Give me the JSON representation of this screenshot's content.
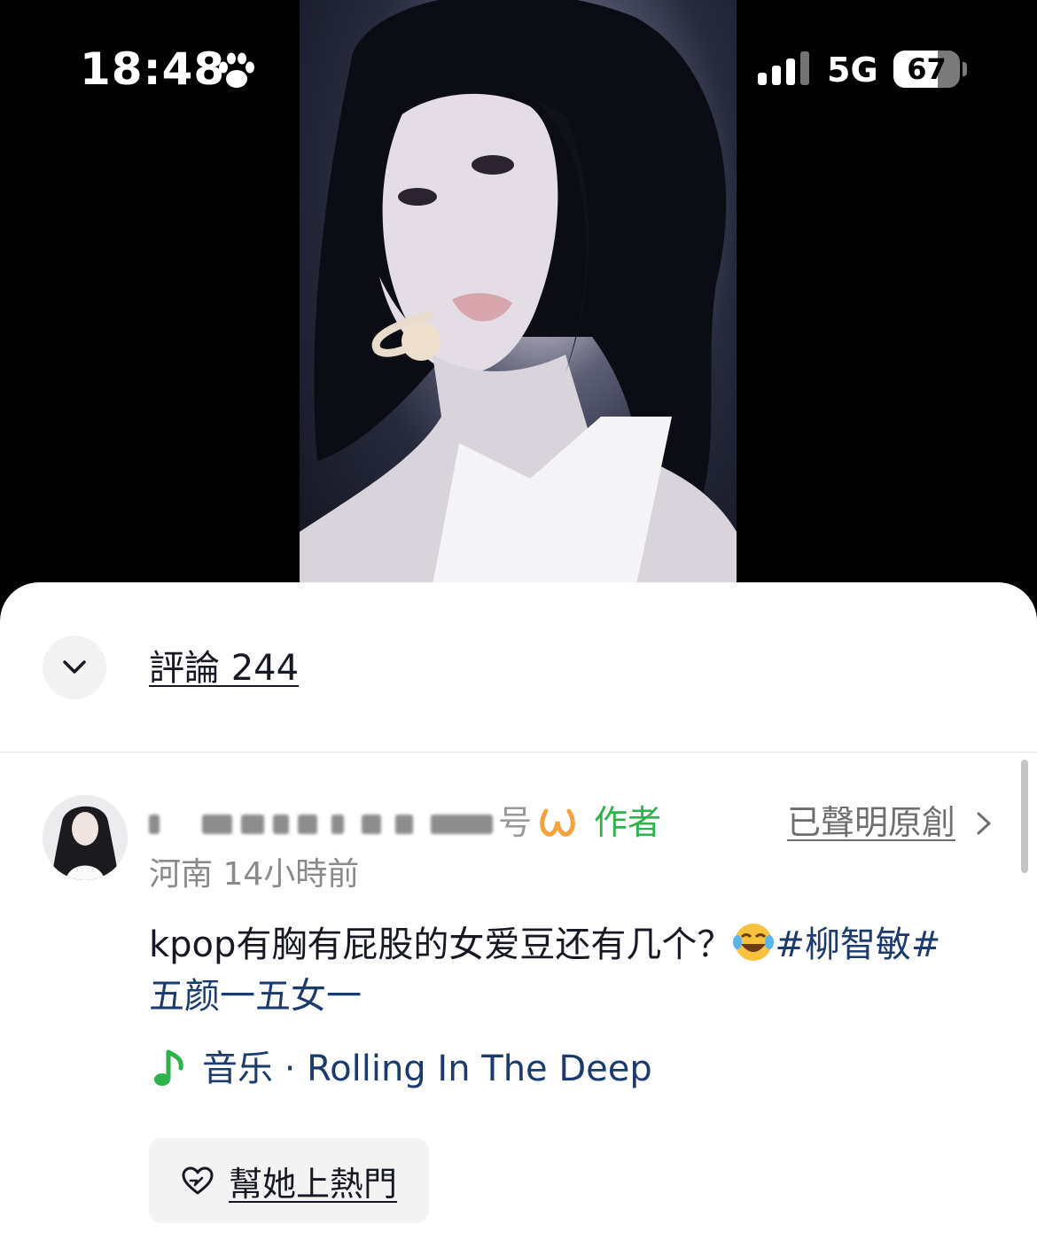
{
  "status_bar": {
    "time": "18:48",
    "time_icon": "paw-icon",
    "signal_icon": "cellular-signal-icon",
    "network": "5G",
    "battery_level": "67",
    "battery_fraction": 0.67
  },
  "video": {
    "content": "performer-closeup-photo"
  },
  "comments_panel": {
    "collapse_icon": "chevron-down-icon",
    "title": "評論 244",
    "post": {
      "avatar_icon": "avatar",
      "username_visible_tail": "号",
      "original_icon": "infinity-icon",
      "author_tag": "作者",
      "declared_original": "已聲明原創",
      "declared_chevron": "chevron-right-icon",
      "meta": "河南 14小時前",
      "text_plain": "kpop有胸有屁股的女爱豆还有几个？",
      "emoji": "laughing-tears-emoji",
      "hashtag_inline": "#柳智敏#",
      "text_line2": "五颜一五女一",
      "music_icon": "music-note-icon",
      "music_label": "音乐 · Rolling In The Deep",
      "hot_button_icon": "heart-boost-icon",
      "hot_button_label": "幫她上熱門"
    }
  },
  "colors": {
    "author_green": "#2cb34a",
    "hashtag_blue": "#1b3a6e",
    "text_dark": "#161823",
    "meta_gray": "#8a8a8a"
  }
}
